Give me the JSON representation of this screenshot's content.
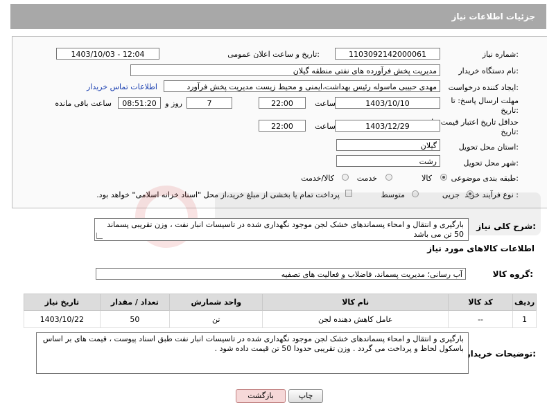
{
  "page": {
    "title": "جزئیات اطلاعات نیاز"
  },
  "form": {
    "need_number": {
      "label": "شماره نیاز:",
      "value": "1103092142000061"
    },
    "announce_datetime": {
      "label": "تاریخ و ساعت اعلان عمومی:",
      "value": "1403/10/03 - 12:04"
    },
    "buyer_org": {
      "label": "نام دستگاه خریدار:",
      "value": "مدیریت پخش فرآورده های نفتی منطقه گیلان"
    },
    "creator": {
      "label": "ایجاد کننده درخواست:",
      "value": "مهدی حبیبی ماسوله رئیس بهداشت،ایمنی و محیط زیست مدیریت پخش فرآورد",
      "link": "اطلاعات تماس خریدار"
    },
    "reply_deadline": {
      "label": "مهلت ارسال پاسخ: تا",
      "label2": "تاریخ:",
      "date": "1403/10/10",
      "time_label": "ساعت",
      "time": "22:00",
      "days": "7",
      "days_label": "روز و",
      "remaining": "08:51:20",
      "remaining_label": "ساعت باقی مانده"
    },
    "price_validity": {
      "label": "حداقل تاریخ اعتبار قیمت: تا",
      "label2": "تاریخ:",
      "date": "1403/12/29",
      "time_label": "ساعت",
      "time": "22:00"
    },
    "province": {
      "label": "استان محل تحویل:",
      "value": "گیلان"
    },
    "city": {
      "label": "شهر محل تحویل:",
      "value": "رشت"
    },
    "category": {
      "label": "طبقه بندی موضوعی:",
      "options": [
        "کالا",
        "خدمت",
        "کالا/خدمت"
      ],
      "selected": "کالا"
    },
    "process": {
      "label": "نوع فرآیند خرید :",
      "options": [
        "جزیی",
        "متوسط"
      ],
      "selected": "جزیی",
      "note": "پرداخت تمام یا بخشی از مبلغ خرید،از محل \"اسناد خزانه اسلامی\" خواهد بود."
    }
  },
  "summary": {
    "label": "شرح کلی نیاز:",
    "value": "بارگیری و انتقال و امحاء پسماندهای خشک لجن موجود نگهداری شده در تاسیسات انبار نفت ، وزن تقریبی پسماند 50 تن می باشد"
  },
  "goods": {
    "header": "اطلاعات کالاهای مورد نیاز",
    "group_label": "گروه کالا:",
    "group_value": "آب رسانی؛ مدیریت پسماند، فاضلاب و فعالیت های تصفیه",
    "columns": [
      "ردیف",
      "کد کالا",
      "نام کالا",
      "واحد شمارش",
      "تعداد / مقدار",
      "تاریخ نیاز"
    ],
    "rows": [
      [
        "1",
        "--",
        "عامل کاهش دهنده لجن",
        "تن",
        "50",
        "1403/10/22"
      ]
    ]
  },
  "buyer_notes": {
    "label": "توضیحات خریدار:",
    "value": "بارگیری و انتقال و امحاء پسماندهای خشک لجن موجود نگهداری شده در تاسیسات انبار نفت طبق اسناد پیوست ، قیمت های بر اساس باسکول لحاظ و پرداخت می گردد . وزن تقریبی حدودا 50 تن قیمت داده شود ."
  },
  "buttons": {
    "print": "چاپ",
    "back": "بازگشت"
  },
  "colors": {
    "titlebar": "#a8a8a8",
    "link": "#1a3fb0",
    "back_button": "#f6d8d8"
  }
}
